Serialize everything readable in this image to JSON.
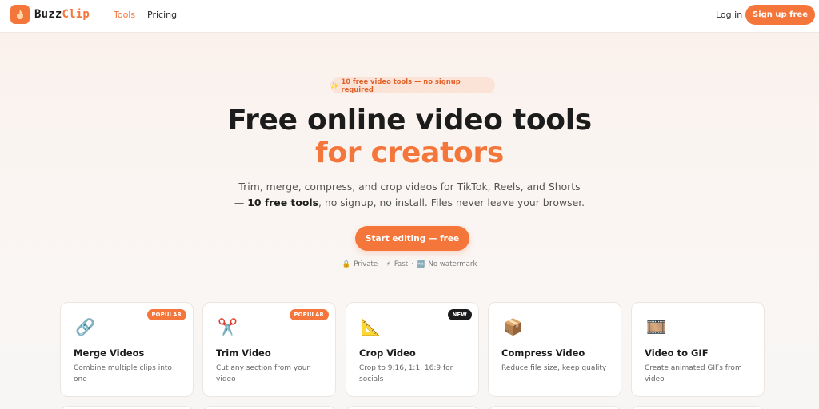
{
  "nav": {
    "brand_a": "Buzz",
    "brand_b": "Clip",
    "links": [
      "Tools",
      "Pricing"
    ],
    "login": "Log in",
    "signup": "Sign up free"
  },
  "hero": {
    "badge_icon": "✨",
    "badge_text": "10 free video tools — no signup required",
    "title_1": "Free online video tools",
    "title_2": "for creators",
    "sub_1": "Trim, merge, compress, and crop videos for TikTok, Reels, and Shorts",
    "sub_2_prefix": "— ",
    "sub_2_bold": "10 free tools",
    "sub_2_rest": ", no signup, no install. Files never leave your browser.",
    "cta": "Start editing — free",
    "perks": [
      {
        "icon": "🔒",
        "label": "Private"
      },
      {
        "icon": "⚡",
        "label": "Fast"
      },
      {
        "icon": "🆓",
        "label": "No watermark"
      }
    ],
    "sep": "·"
  },
  "tools": [
    {
      "icon": "🔗",
      "title": "Merge Videos",
      "desc": "Combine multiple clips into one",
      "tag": "POPULAR"
    },
    {
      "icon": "✂️",
      "title": "Trim Video",
      "desc": "Cut any section from your video",
      "tag": "POPULAR"
    },
    {
      "icon": "📐",
      "title": "Crop Video",
      "desc": "Crop to 9:16, 1:1, 16:9 for socials",
      "tag": "NEW"
    },
    {
      "icon": "📦",
      "title": "Compress Video",
      "desc": "Reduce file size, keep quality",
      "tag": ""
    },
    {
      "icon": "🎞️",
      "title": "Video to GIF",
      "desc": "Create animated GIFs from video",
      "tag": ""
    }
  ],
  "colors": {
    "accent": "#f4763b",
    "dark": "#1c1c1c"
  }
}
